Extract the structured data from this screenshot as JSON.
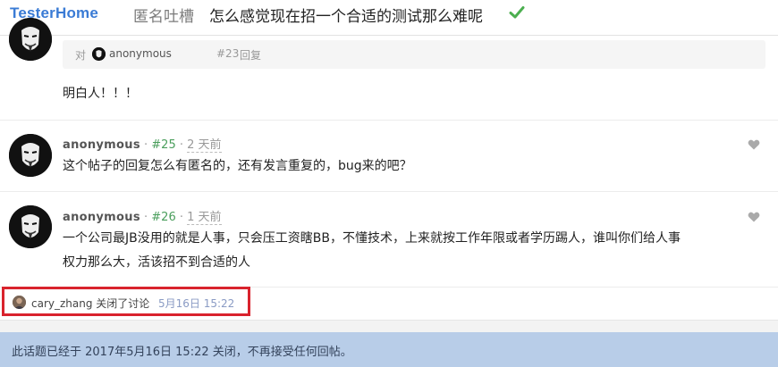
{
  "header": {
    "brand": "TesterHome",
    "node": "匿名吐槽",
    "title": "怎么感觉现在招一个合适的测试那么难呢"
  },
  "quoted_reply": {
    "prefix": "对",
    "user": "anonymous",
    "floor": "#23",
    "action": "回复"
  },
  "reply_24": {
    "body": "明白人！！！"
  },
  "reply_25": {
    "user": "anonymous",
    "floor": "#25",
    "time": "2 天前",
    "body": "这个帖子的回复怎么有匿名的，还有发言重复的，bug来的吧？"
  },
  "reply_26": {
    "user": "anonymous",
    "floor": "#26",
    "time": "1 天前",
    "body_line1": "一个公司最JB没用的就是人事，只会压工资瞎BB，不懂技术，上来就按工作年限或者学历踢人，谁叫你们给人事",
    "body_line2": "权力那么大，活该招不到合适的人"
  },
  "closed_event": {
    "text": "cary_zhang 关闭了讨论",
    "time": "5月16日 15:22"
  },
  "footer": {
    "notice": "此话题已经于 2017年5月16日 15:22 关闭，不再接受任何回帖。"
  },
  "meta_separator": "·",
  "colors": {
    "brand": "#3a7bd5",
    "check": "#4caf50",
    "floor": "#4a9e5c",
    "highlight_border": "#d9232d",
    "notice_bg": "#b8cde8"
  }
}
